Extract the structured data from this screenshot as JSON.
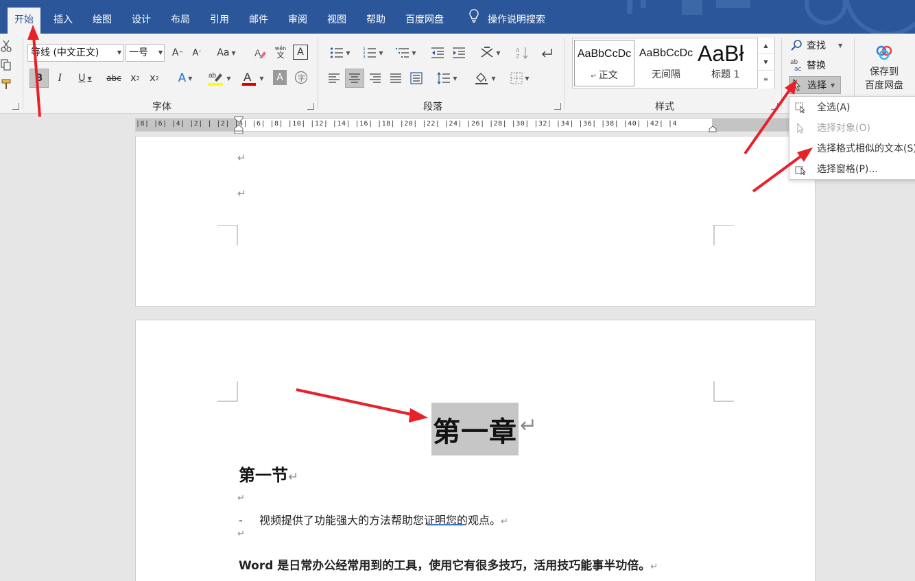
{
  "tabs": [
    "开始",
    "插入",
    "绘图",
    "设计",
    "布局",
    "引用",
    "邮件",
    "审阅",
    "视图",
    "帮助",
    "百度网盘"
  ],
  "tell_me": "操作说明搜索",
  "font": {
    "name": "等线 (中文正文)",
    "size": "一号",
    "group_label": "字体"
  },
  "paragraph": {
    "group_label": "段落"
  },
  "styles": {
    "group_label": "样式",
    "items": [
      {
        "preview": "AaBbCcDc",
        "name": "正文"
      },
      {
        "preview": "AaBbCcDc",
        "name": "无间隔"
      },
      {
        "preview": "AaBł",
        "name": "标题 1"
      }
    ]
  },
  "editing": {
    "find": "查找",
    "replace": "替换",
    "select": "选择"
  },
  "baidu": {
    "line1": "保存到",
    "line2": "百度网盘"
  },
  "ruler_text": "|8|  |6|  |4|  |2|   |   |2|  |4|  |6|  |8|  |10|  |12|  |14|  |16|  |18|  |20|  |22|  |24|  |26|  |28|  |30|  |32|  |34|  |36|  |38|  |40|  |42|  |4",
  "select_menu": [
    {
      "label": "全选(A)",
      "icon": "select-all-icon",
      "disabled": false
    },
    {
      "label": "选择对象(O)",
      "icon": "cursor-arrow-icon",
      "disabled": true
    },
    {
      "label": "选择格式相似的文本(S)",
      "icon": "",
      "disabled": false
    },
    {
      "label": "选择窗格(P)...",
      "icon": "selection-pane-icon",
      "disabled": false
    }
  ],
  "document": {
    "chapter_heading": "第一章",
    "section_heading": "第一节",
    "bullet_text": "视频提供了功能强大的方法帮助您证明您的观点。",
    "bullet_dash": "-",
    "bold_para": "Word 是日常办公经常用到的工具，使用它有很多技巧，活用技巧能事半功倍。",
    "para_mark": "↵"
  },
  "colors": {
    "title_bar": "#2b579a",
    "ribbon_bg": "#f3f3f3",
    "highlight_selection": "#c6c6c6",
    "annotation_arrow": "#e8202a",
    "font_color_bar": "#e00000",
    "highlight_bar": "#ffff00"
  }
}
